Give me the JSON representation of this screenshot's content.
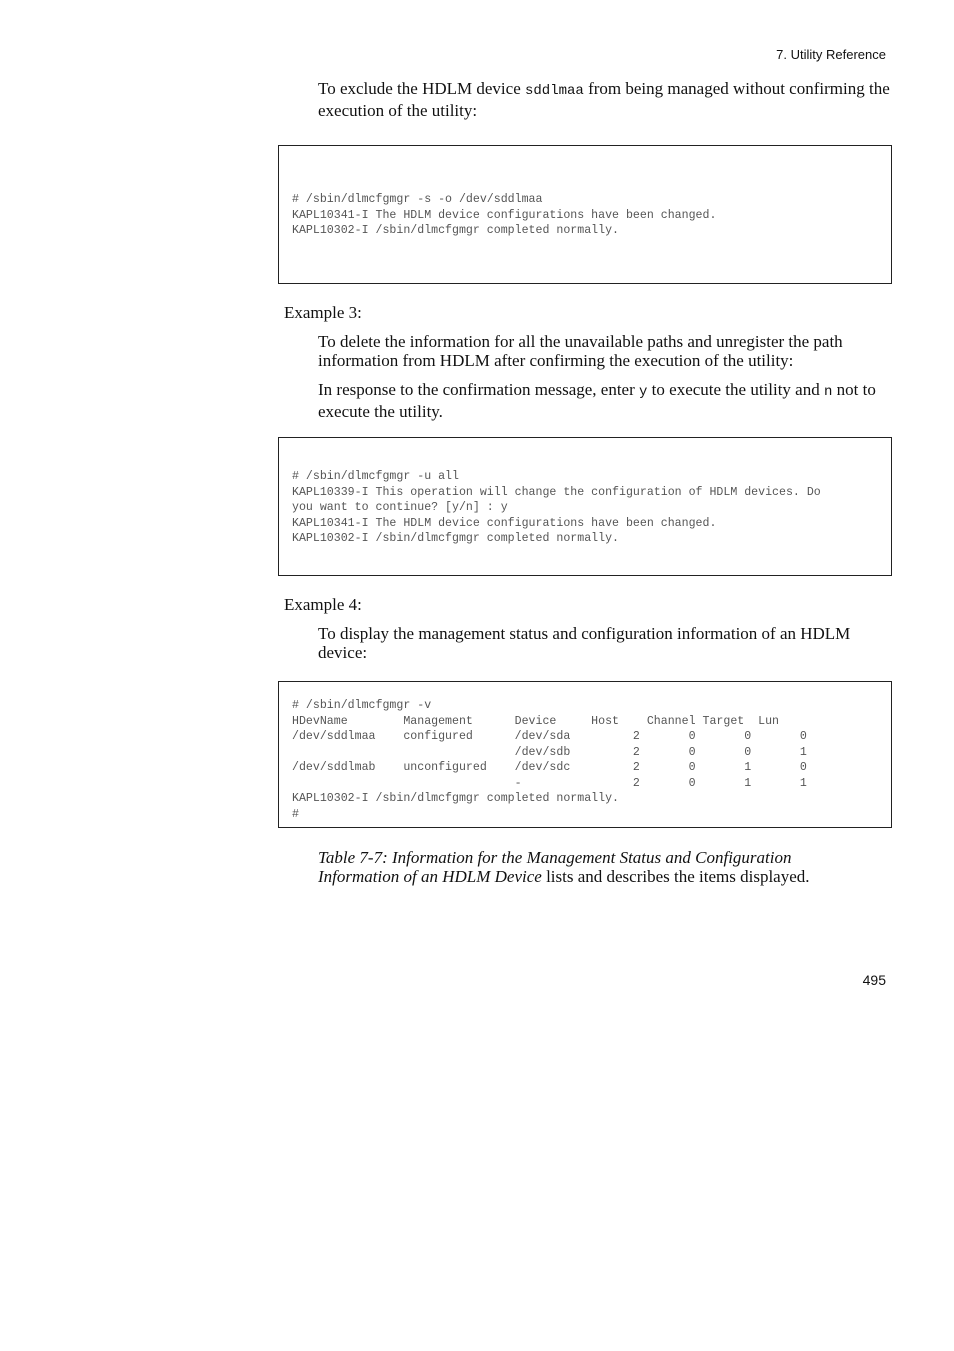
{
  "header": {
    "section": "7.  Utility Reference"
  },
  "intro": {
    "text_before": "To exclude the HDLM device ",
    "code": "sddlmaa",
    "text_after": " from being managed without confirming the execution of the utility:"
  },
  "code_block_1": {
    "lines": [
      "# /sbin/dlmcfgmgr -s -o /dev/sddlmaa",
      "KAPL10341-I The HDLM device configurations have been changed.",
      "KAPL10302-I /sbin/dlmcfgmgr completed normally."
    ]
  },
  "example3": {
    "label": "Example 3:",
    "desc": "To delete the information for all the unavailable paths and unregister the path information from HDLM after confirming the execution of the utility:",
    "response_before": "In response to the confirmation message, enter ",
    "response_y": "y",
    "response_mid": " to execute the utility and ",
    "response_n": "n",
    "response_after": " not to execute the utility."
  },
  "code_block_2": {
    "lines": [
      "# /sbin/dlmcfgmgr -u all",
      "KAPL10339-I This operation will change the configuration of HDLM devices. Do",
      "you want to continue? [y/n] : y",
      "KAPL10341-I The HDLM device configurations have been changed.",
      "KAPL10302-I /sbin/dlmcfgmgr completed normally."
    ]
  },
  "example4": {
    "label": "Example 4:",
    "desc": "To display the management status and configuration information of an HDLM device:"
  },
  "code_block_3": {
    "lines": [
      "# /sbin/dlmcfgmgr -v",
      "HDevName        Management      Device     Host    Channel Target  Lun",
      "/dev/sddlmaa    configured      /dev/sda         2       0       0       0",
      "                                /dev/sdb         2       0       0       1",
      "/dev/sddlmab    unconfigured    /dev/sdc         2       0       1       0",
      "                                -                2       0       1       1",
      "KAPL10302-I /sbin/dlmcfgmgr completed normally.",
      "#"
    ]
  },
  "table_ref": {
    "italic": "Table  7-7:  Information for the Management Status and Configuration Information of an HDLM Device",
    "rest": " lists and describes the items displayed."
  },
  "footer": {
    "page_number": "495"
  }
}
